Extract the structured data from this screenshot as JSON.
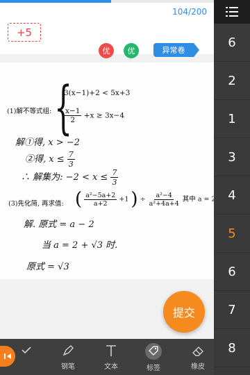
{
  "header": {
    "counter": "104/200",
    "progress_fraction": 0.52,
    "score": "+5"
  },
  "tags": {
    "badge_red": "优",
    "badge_green": "优",
    "abnormal": "异常卷"
  },
  "sheet": {
    "q1_label": "(1)解不等式组:",
    "q1_line1": "3(x−1)+2 < 5x+3",
    "q1_frac_num": "x−1",
    "q1_frac_den": "2",
    "q1_line2_rest": "+x ≥ 3x−4",
    "hw1_a": "解①得,  x > −2",
    "hw1_b_prefix": "②得,  x ≤",
    "hw1_b_num": "7",
    "hw1_b_den": "3",
    "hw1_c_prefix": "∴ 解集为: −2 < x ≤",
    "hw1_c_num": "7",
    "hw1_c_den": "3",
    "q3_label": "(3)先化简, 再求值:",
    "q3_f1_num": "a²−5a+2",
    "q3_f1_den": "a+2",
    "q3_plus1": "+1",
    "q3_div": "÷",
    "q3_f2_num": "a²−4",
    "q3_f2_den": "a²+4a+4",
    "q3_tail": "其中 a = 2 +",
    "hw3_a": "解. 原式 = a − 2",
    "hw3_b": "当 a = 2 + √3 时.",
    "hw3_c": "原式 = √3"
  },
  "submit_label": "提交",
  "toolbar": {
    "pen": "钢笔",
    "text": "文本",
    "tag": "标签",
    "eraser": "橡皮"
  },
  "rightnav": {
    "items": [
      "6",
      "2",
      "1",
      "3",
      "4",
      "5",
      "6",
      "7",
      "8"
    ],
    "active_index": 5
  }
}
